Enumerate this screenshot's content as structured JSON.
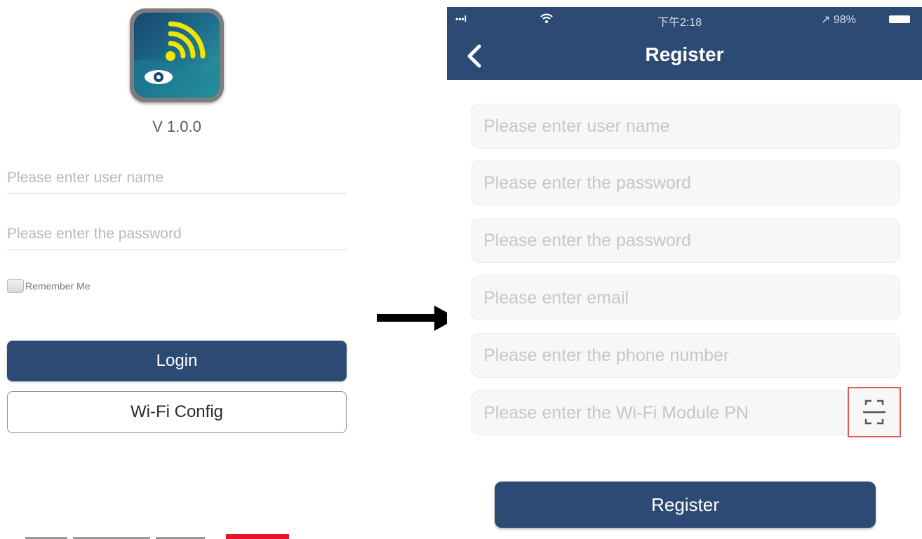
{
  "login": {
    "version": "V 1.0.0",
    "username_placeholder": "Please enter user name",
    "password_placeholder": "Please enter the password",
    "remember_label": "Remember Me",
    "login_label": "Login",
    "wifi_config_label": "Wi-Fi Config"
  },
  "register": {
    "status": {
      "signal": "•••l",
      "time": "下午2:18",
      "battery_text": "↗ 98%"
    },
    "title": "Register",
    "fields": {
      "username_placeholder": "Please enter user name",
      "password_placeholder": "Please enter the password",
      "confirm_password_placeholder": "Please enter the password",
      "email_placeholder": "Please enter email",
      "phone_placeholder": "Please enter the phone number",
      "wifi_pn_placeholder": "Please enter the Wi-Fi Module PN"
    },
    "register_label": "Register"
  },
  "icons": {
    "app": "wifi-eye-app-icon",
    "arrow": "right-arrow-icon",
    "back": "chevron-left-icon",
    "scan": "qr-scan-icon"
  },
  "colors": {
    "brand_navy": "#2c4a73",
    "scan_highlight": "#e35656"
  }
}
